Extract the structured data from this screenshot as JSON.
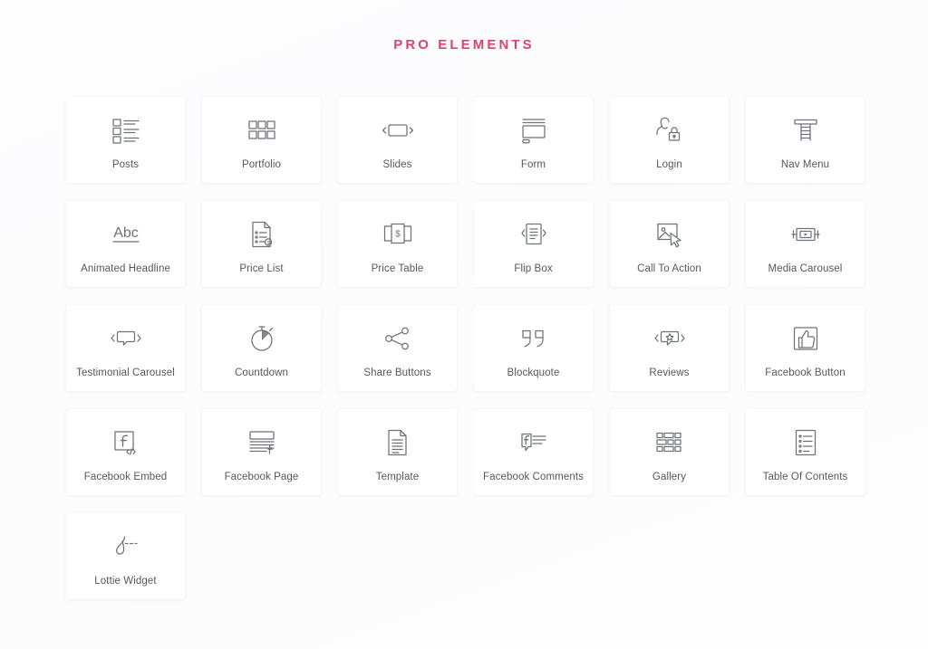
{
  "header": {
    "title": "PRO ELEMENTS",
    "title_color": "#d6456a"
  },
  "theme": {
    "background": "#fdfdfd",
    "card_background": "#ffffff",
    "label_color": "#54585e",
    "icon_color": "#6e727a"
  },
  "grid": {
    "columns": 6,
    "items": [
      {
        "label": "Posts",
        "icon": "posts-icon"
      },
      {
        "label": "Portfolio",
        "icon": "portfolio-icon"
      },
      {
        "label": "Slides",
        "icon": "slides-icon"
      },
      {
        "label": "Form",
        "icon": "form-icon"
      },
      {
        "label": "Login",
        "icon": "login-icon"
      },
      {
        "label": "Nav Menu",
        "icon": "nav-menu-icon"
      },
      {
        "label": "Animated Headline",
        "icon": "animated-headline-icon"
      },
      {
        "label": "Price List",
        "icon": "price-list-icon"
      },
      {
        "label": "Price Table",
        "icon": "price-table-icon"
      },
      {
        "label": "Flip Box",
        "icon": "flip-box-icon"
      },
      {
        "label": "Call To Action",
        "icon": "call-to-action-icon"
      },
      {
        "label": "Media Carousel",
        "icon": "media-carousel-icon"
      },
      {
        "label": "Testimonial Carousel",
        "icon": "testimonial-carousel-icon"
      },
      {
        "label": "Countdown",
        "icon": "countdown-icon"
      },
      {
        "label": "Share Buttons",
        "icon": "share-buttons-icon"
      },
      {
        "label": "Blockquote",
        "icon": "blockquote-icon"
      },
      {
        "label": "Reviews",
        "icon": "reviews-icon"
      },
      {
        "label": "Facebook Button",
        "icon": "facebook-button-icon"
      },
      {
        "label": "Facebook Embed",
        "icon": "facebook-embed-icon"
      },
      {
        "label": "Facebook Page",
        "icon": "facebook-page-icon"
      },
      {
        "label": "Template",
        "icon": "template-icon"
      },
      {
        "label": "Facebook Comments",
        "icon": "facebook-comments-icon"
      },
      {
        "label": "Gallery",
        "icon": "gallery-icon"
      },
      {
        "label": "Table Of Contents",
        "icon": "table-of-contents-icon"
      },
      {
        "label": "Lottie Widget",
        "icon": "lottie-widget-icon"
      }
    ]
  }
}
